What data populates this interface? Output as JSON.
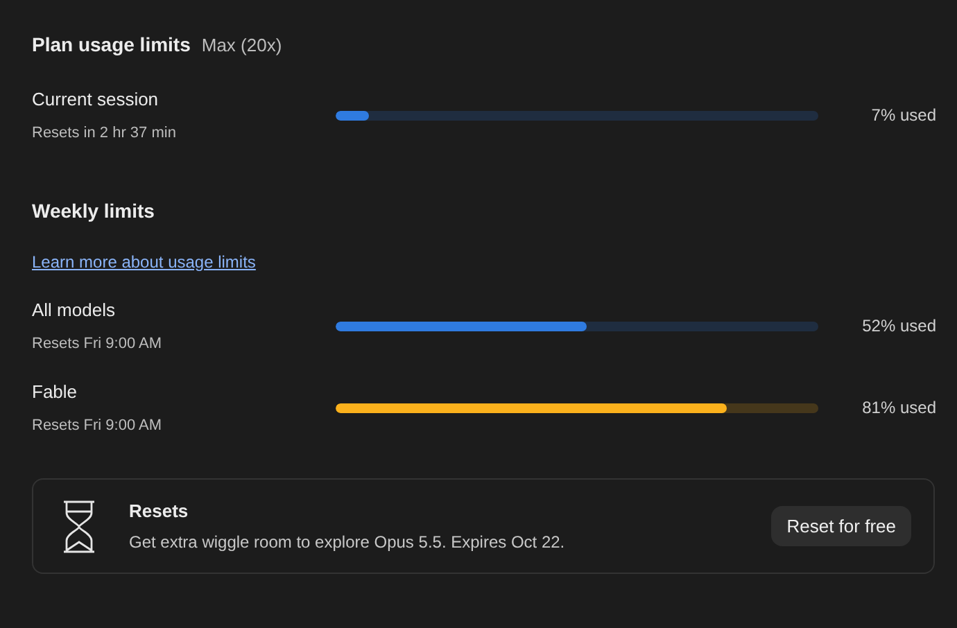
{
  "header": {
    "title": "Plan usage limits",
    "plan": "Max (20x)"
  },
  "session_limits": [
    {
      "name": "Current session",
      "resets": "Resets in 2 hr 37 min",
      "level": 0.07,
      "color": "#2f7be0",
      "reading": "7% used"
    }
  ],
  "weekly": {
    "title": "Weekly limits",
    "link": "Learn more about usage limits",
    "limits": [
      {
        "name": "All models",
        "resets": "Resets Fri 9:00 AM",
        "level": 0.52,
        "color": "#2f7be0",
        "reading": "52% used"
      },
      {
        "name": "Fable",
        "resets": "Resets Fri 9:00 AM",
        "level": 0.81,
        "color": "#fbb11c",
        "reading": "81% used"
      }
    ]
  },
  "reset_card": {
    "title": "Resets",
    "description": "Get extra wiggle room to explore Opus 5.5. Expires Oct 22.",
    "button": "Reset for free"
  }
}
